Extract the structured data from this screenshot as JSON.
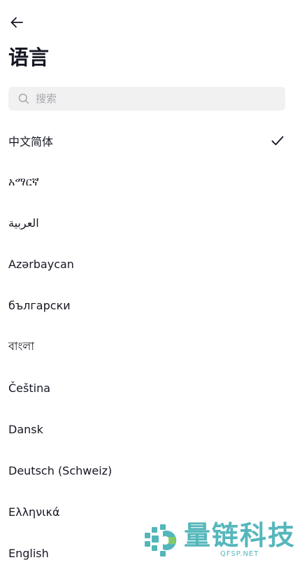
{
  "header": {
    "back_icon": "arrow-left-icon",
    "title": "语言"
  },
  "search": {
    "icon": "search-icon",
    "placeholder": "搜索",
    "value": ""
  },
  "languages": [
    {
      "label": "中文简体",
      "selected": true
    },
    {
      "label": "አማርኛ",
      "selected": false
    },
    {
      "label": "العربية",
      "selected": false
    },
    {
      "label": "Azərbaycan",
      "selected": false
    },
    {
      "label": "български",
      "selected": false
    },
    {
      "label": "বাংলা",
      "selected": false
    },
    {
      "label": "Čeština",
      "selected": false
    },
    {
      "label": "Dansk",
      "selected": false
    },
    {
      "label": "Deutsch (Schweiz)",
      "selected": false
    },
    {
      "label": "Ελληνικά",
      "selected": false
    },
    {
      "label": "English",
      "selected": false
    }
  ],
  "watermark": {
    "name": "量链科技",
    "sub": "QFSP.NET"
  },
  "colors": {
    "text": "#161823",
    "search_bg": "#f1f1f2",
    "placeholder": "#a7a8ad",
    "watermark": "#36aaaf"
  }
}
